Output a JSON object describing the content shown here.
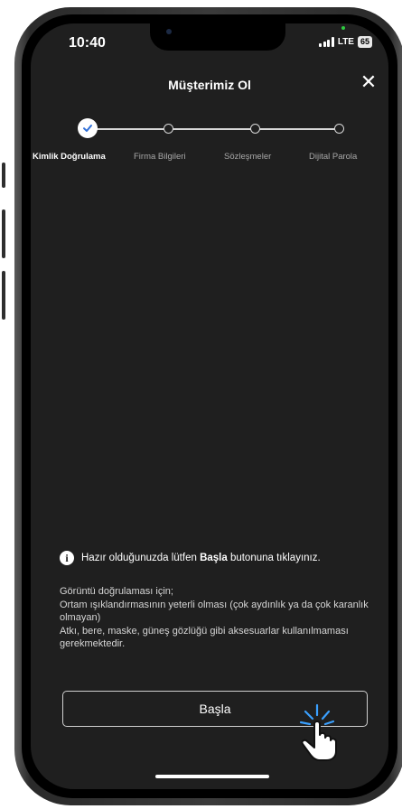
{
  "status_bar": {
    "time": "10:40",
    "network": "LTE",
    "battery": "65"
  },
  "header": {
    "title": "Müşterimiz Ol",
    "close_icon": "close-icon"
  },
  "stepper": {
    "steps": [
      {
        "label": "Kimlik Doğrulama",
        "state": "completed"
      },
      {
        "label": "Firma Bilgileri",
        "state": "pending"
      },
      {
        "label": "Sözleşmeler",
        "state": "pending"
      },
      {
        "label": "Dijital Parola",
        "state": "pending"
      }
    ]
  },
  "info": {
    "icon": "info-icon",
    "text_before": "Hazır olduğunuzda lütfen ",
    "text_bold": "Başla",
    "text_after": " butonuna tıklayınız."
  },
  "notes": {
    "lines": [
      "Görüntü doğrulaması için;",
      "Ortam ışıklandırmasının yeterli olması (çok aydınlık ya da çok karanlık olmayan)",
      "Atkı, bere, maske, güneş gözlüğü gibi aksesuarlar kullanılmaması gerekmektedir."
    ]
  },
  "actions": {
    "start_label": "Başla"
  },
  "colors": {
    "screen_bg": "#1f1f1f",
    "text": "#ffffff",
    "step_check": "#2f6fd8"
  }
}
